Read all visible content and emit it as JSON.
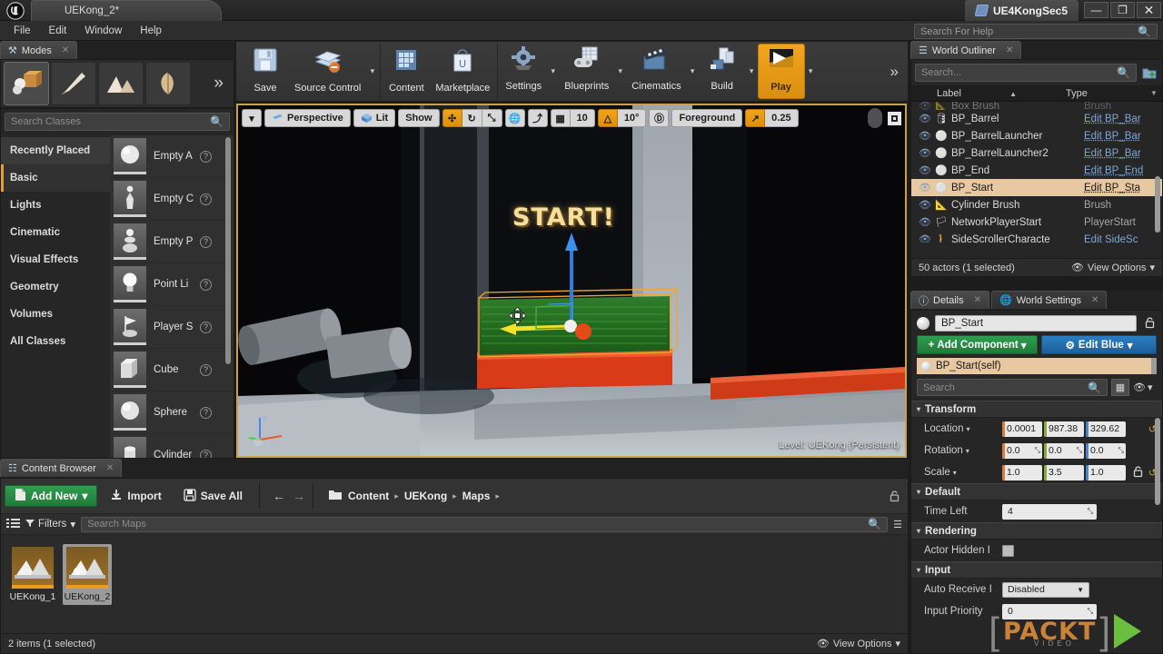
{
  "titlebar": {
    "project_tab": "UEKong_2*",
    "window_title": "UE4KongSec5",
    "minimize": "—",
    "maximize": "❐",
    "close": "✕"
  },
  "menubar": {
    "items": [
      "File",
      "Edit",
      "Window",
      "Help"
    ],
    "help_search_placeholder": "Search For Help"
  },
  "modes": {
    "tab_label": "Modes",
    "buttons": [
      {
        "name": "place-mode",
        "icon": "📦",
        "selected": true
      },
      {
        "name": "paint-mode",
        "icon": "🖌",
        "selected": false
      },
      {
        "name": "landscape-mode",
        "icon": "⛰",
        "selected": false
      },
      {
        "name": "foliage-mode",
        "icon": "🌿",
        "selected": false
      }
    ],
    "more": "»"
  },
  "placement": {
    "search_placeholder": "Search Classes",
    "categories": [
      {
        "label": "Recently Placed",
        "state": "hover"
      },
      {
        "label": "Basic",
        "state": "selected"
      },
      {
        "label": "Lights",
        "state": "normal"
      },
      {
        "label": "Cinematic",
        "state": "normal"
      },
      {
        "label": "Visual Effects",
        "state": "normal"
      },
      {
        "label": "Geometry",
        "state": "normal"
      },
      {
        "label": "Volumes",
        "state": "normal"
      },
      {
        "label": "All Classes",
        "state": "normal"
      }
    ],
    "assets": [
      {
        "label": "Empty A",
        "icon": "⚪"
      },
      {
        "label": "Empty C",
        "icon": "🚶"
      },
      {
        "label": "Empty P",
        "icon": "♟"
      },
      {
        "label": "Point Li",
        "icon": "💡"
      },
      {
        "label": "Player S",
        "icon": "🏳"
      },
      {
        "label": "Cube",
        "icon": "⬜"
      },
      {
        "label": "Sphere",
        "icon": "⚫"
      },
      {
        "label": "Cylinder",
        "icon": "▭"
      }
    ],
    "help_glyph": "?"
  },
  "toolbar": {
    "groups": [
      {
        "items": [
          {
            "label": "Save",
            "icon": "💾",
            "caret": false,
            "style": "normal"
          },
          {
            "label": "Source Control",
            "icon": "🗂",
            "caret": true,
            "style": "normal"
          }
        ]
      },
      {
        "items": [
          {
            "label": "Content",
            "icon": "🗃",
            "caret": false,
            "style": "normal"
          },
          {
            "label": "Marketplace",
            "icon": "🛍",
            "caret": false,
            "style": "normal"
          }
        ]
      },
      {
        "items": [
          {
            "label": "Settings",
            "icon": "⚙",
            "caret": true,
            "style": "normal"
          },
          {
            "label": "Blueprints",
            "icon": "🎮",
            "caret": true,
            "style": "normal"
          },
          {
            "label": "Cinematics",
            "icon": "🎬",
            "caret": true,
            "style": "normal"
          },
          {
            "label": "Build",
            "icon": "🏗",
            "caret": true,
            "style": "normal"
          },
          {
            "label": "Play",
            "icon": "▶",
            "caret": true,
            "style": "play"
          }
        ]
      }
    ],
    "overflow": "»"
  },
  "viewport": {
    "view_menu_caret": "▾",
    "camera_mode": "Perspective",
    "view_mode": "Lit",
    "show_menu": "Show",
    "transform_tools": [
      {
        "name": "translate-tool",
        "glyph": "✣",
        "active": true
      },
      {
        "name": "rotate-tool",
        "glyph": "↻",
        "active": false
      },
      {
        "name": "scale-tool",
        "glyph": "⤡",
        "active": false
      }
    ],
    "coord_system": "🌐",
    "surface_snap": "⤴",
    "grid_snap_icon": "▦",
    "grid_snap_value": "10",
    "angle_snap_icon": "△",
    "angle_snap_value": "10°",
    "scale_snap_icon": "Ⓓ",
    "camera_speed_label": "Foreground",
    "camera_speed_icon": "↗",
    "camera_speed_value": "0.25",
    "maximize_icon": "▣",
    "level_label": "Level:  UEKong (Persistent)",
    "scene_text": "START!",
    "cursor_glyph": "✥"
  },
  "outliner": {
    "tab_label": "World Outliner",
    "search_placeholder": "Search...",
    "add_icon": "➕",
    "columns": {
      "label": "Label",
      "type": "Type",
      "sort_arrow": "▲",
      "menu_arrow": "▼"
    },
    "rows": [
      {
        "label": "Box Brush",
        "type": "Brush",
        "type_link": false,
        "selected": false,
        "clipped": true,
        "icon": "📐"
      },
      {
        "label": "BP_Barrel",
        "type": "Edit BP_Bar",
        "type_link": true,
        "selected": false,
        "clipped": false,
        "icon": "🛢"
      },
      {
        "label": "BP_BarrelLauncher",
        "type": "Edit BP_Bar",
        "type_link": true,
        "selected": false,
        "clipped": false,
        "icon": "⚪"
      },
      {
        "label": "BP_BarrelLauncher2",
        "type": "Edit BP_Bar",
        "type_link": true,
        "selected": false,
        "clipped": false,
        "icon": "⚪"
      },
      {
        "label": "BP_End",
        "type": "Edit BP_End",
        "type_link": true,
        "selected": false,
        "clipped": false,
        "icon": "⚪"
      },
      {
        "label": "BP_Start",
        "type": "Edit BP_Sta",
        "type_link": true,
        "selected": true,
        "clipped": false,
        "icon": "⚪"
      },
      {
        "label": "Cylinder Brush",
        "type": "Brush",
        "type_link": false,
        "selected": false,
        "clipped": false,
        "icon": "📐"
      },
      {
        "label": "NetworkPlayerStart",
        "type": "PlayerStart",
        "type_link": false,
        "selected": false,
        "clipped": false,
        "icon": "🏳"
      },
      {
        "label": "SideScrollerCharacte",
        "type": "Edit SideSc",
        "type_link": true,
        "selected": false,
        "clipped": false,
        "icon": "🚶"
      }
    ],
    "eye_icon": "👁",
    "footer_status": "50 actors (1 selected)",
    "view_options": "View Options"
  },
  "details": {
    "tabs": [
      {
        "label": "Details",
        "icon": "ℹ",
        "active": true
      },
      {
        "label": "World Settings",
        "icon": "🌍",
        "active": false
      }
    ],
    "actor_name": "BP_Start",
    "lock_icon": "🔓",
    "add_component_label": "Add Component",
    "add_component_caret": "▾",
    "edit_blueprint_label": "Edit Blue",
    "edit_blueprint_caret": "▾",
    "component_root": "BP_Start(self)",
    "search_placeholder": "Search",
    "grid_icon": "▦",
    "eye_icon": "👁",
    "sections": [
      {
        "title": "Transform",
        "rows": [
          {
            "type": "vector",
            "label": "Location",
            "has_caret": true,
            "values": [
              "0.0001",
              "987.38",
              "329.62"
            ],
            "reset": true,
            "lock": false
          },
          {
            "type": "vector",
            "label": "Rotation",
            "has_caret": true,
            "values": [
              "0.0",
              "0.0",
              "0.0"
            ],
            "spinner": true,
            "reset": false,
            "lock": false
          },
          {
            "type": "vector",
            "label": "Scale",
            "has_caret": true,
            "values": [
              "1.0",
              "3.5",
              "1.0"
            ],
            "reset": true,
            "lock": true
          }
        ]
      },
      {
        "title": "Default",
        "rows": [
          {
            "type": "field",
            "label": "Time Left",
            "value": "4",
            "spinner": true
          }
        ]
      },
      {
        "title": "Rendering",
        "rows": [
          {
            "type": "checkbox",
            "label": "Actor Hidden I",
            "checked": false
          }
        ]
      },
      {
        "title": "Input",
        "rows": [
          {
            "type": "combo",
            "label": "Auto Receive I",
            "value": "Disabled"
          },
          {
            "type": "field",
            "label": "Input Priority",
            "value": "0",
            "spinner": true
          }
        ]
      }
    ],
    "reset_glyph": "↺",
    "spin_glyph": "⤡"
  },
  "content_browser": {
    "tab_label": "Content Browser",
    "add_new_label": "Add New",
    "add_new_caret": "▾",
    "add_new_icon": "📄",
    "import_label": "Import",
    "import_icon": "⬇",
    "save_all_label": "Save All",
    "save_all_icon": "💾",
    "nav_back": "←",
    "nav_forward": "→",
    "folder_icon": "📁",
    "breadcrumbs": [
      "Content",
      "UEKong",
      "Maps"
    ],
    "breadcrumb_sep": "▸",
    "filters_label": "Filters",
    "filters_icon": "▼",
    "filters_caret": "▾",
    "list_icon": "≣",
    "search_placeholder": "Search Maps",
    "lock_icon": "🔓",
    "assets": [
      {
        "name": "UEKong_1",
        "selected": false,
        "icon": "🗻"
      },
      {
        "name": "UEKong_2",
        "selected": true,
        "icon": "🗻"
      }
    ],
    "footer_status": "2 items (1 selected)",
    "view_options": "View Options"
  },
  "watermark": {
    "bracket_left": "[",
    "bracket_right": "]",
    "text": "PACKT",
    "subtext": "VIDEO"
  },
  "colors": {
    "accent_orange": "#e0a32e",
    "selection_tan": "#e8c8a0",
    "green_button": "#2f9e4f",
    "blue_button": "#2a7fc4",
    "link_blue": "#7fa7d8"
  }
}
